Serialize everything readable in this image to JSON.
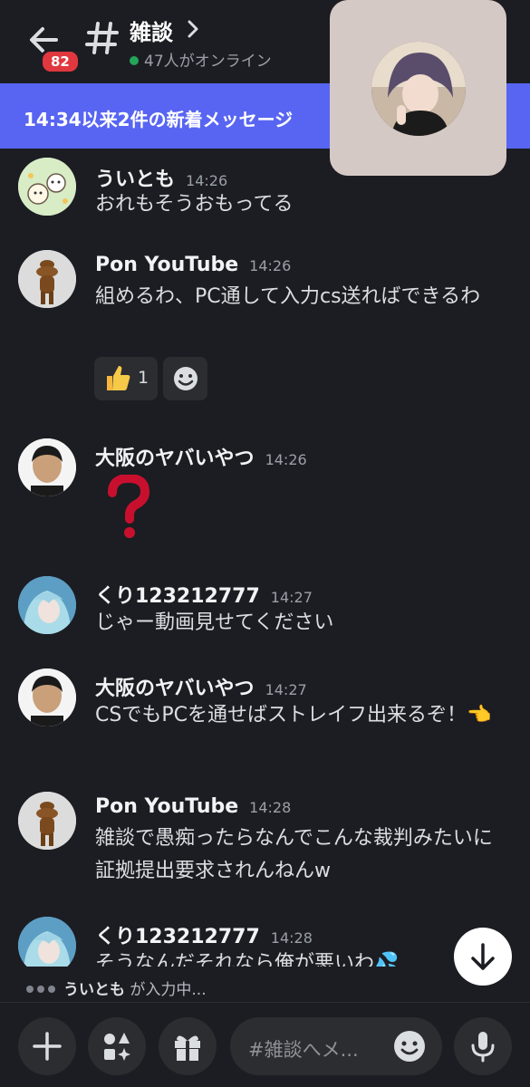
{
  "header": {
    "badge_count": "82",
    "channel_name": "雑談",
    "online_text": "47人がオンライン"
  },
  "new_messages_bar": "14:34以来2件の新着メッセージ",
  "messages": [
    {
      "user": "ういとも",
      "time": "14:26",
      "text": "おれもそうおもってる"
    },
    {
      "user": "Pon YouTube",
      "time": "14:26",
      "text": "組めるわ、PC通して入力cs送ればできるわ",
      "reaction_emoji": "thumbs-up",
      "reaction_count": "1"
    },
    {
      "user": "大阪のヤバいやつ",
      "time": "14:26",
      "text": "❓"
    },
    {
      "user": "くり123212777",
      "time": "14:27",
      "text": "じゃー動画見せてください"
    },
    {
      "user": "大阪のヤバいやつ",
      "time": "14:27",
      "text": "CSでもPCを通せばストレイフ出来るぞ！👈"
    },
    {
      "user": "Pon YouTube",
      "time": "14:28",
      "text": "雑談で愚痴ったらなんでこんな裁判みたいに証拠提出要求されんねんw"
    },
    {
      "user": "くり123212777",
      "time": "14:28",
      "text": "そうなんだそれなら俺が悪いわ💦"
    }
  ],
  "typing": {
    "user": "ういとも",
    "suffix": " が入力中..."
  },
  "composer": {
    "placeholder": "#雑談へメ..."
  },
  "colors": {
    "background": "#1c1d22",
    "accent": "#5865f2",
    "badge": "#e0383e",
    "online": "#23a559"
  }
}
